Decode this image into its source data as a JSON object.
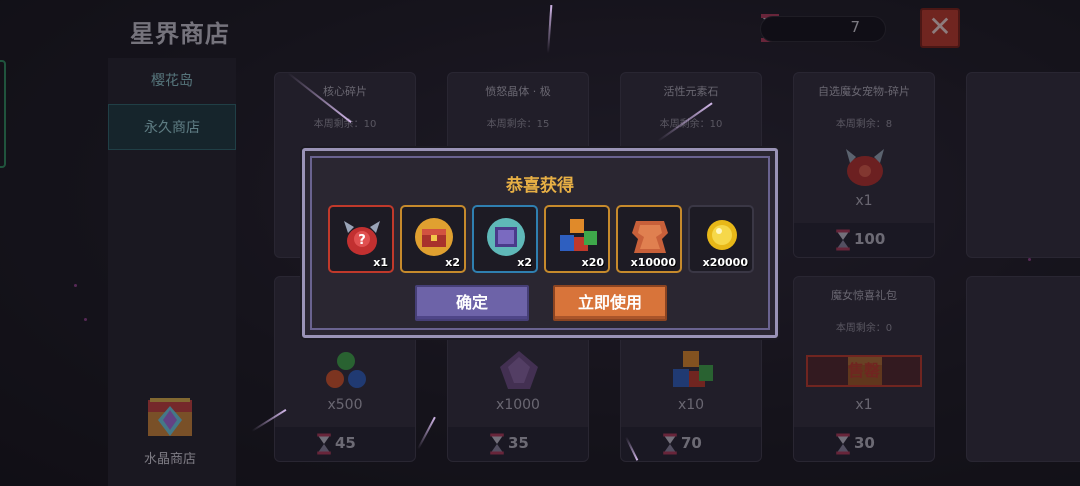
{
  "header": {
    "title": "星界商店",
    "currency_value": "7",
    "close_label": "✕"
  },
  "sidebar": {
    "items": [
      {
        "label": "樱花岛"
      },
      {
        "label": "永久商店"
      }
    ],
    "crystal_shop_label": "水晶商店"
  },
  "cards": [
    {
      "name": "核心碎片",
      "limit": "本周剩余：10",
      "qty": "",
      "price": ""
    },
    {
      "name": "愤怒晶体 · 极",
      "limit": "本周剩余：15",
      "qty": "",
      "price": ""
    },
    {
      "name": "活性元素石",
      "limit": "本周剩余：10",
      "qty": "",
      "price": ""
    },
    {
      "name": "自选魔女宠物-碎片",
      "limit": "本周剩余：8",
      "qty": "x1",
      "price": "100"
    },
    {
      "name": "",
      "limit": "",
      "qty": "x500",
      "price": "45"
    },
    {
      "name": "",
      "limit": "",
      "qty": "x1000",
      "price": "35"
    },
    {
      "name": "",
      "limit": "",
      "qty": "x10",
      "price": "70"
    },
    {
      "name": "魔女惊喜礼包",
      "limit": "本周剩余：0",
      "qty": "x1",
      "price": "30",
      "sold_out": "售罄"
    }
  ],
  "modal": {
    "title": "恭喜获得",
    "rewards": [
      {
        "qty": "x1",
        "icon": "mystery-egg-icon",
        "border": "#c0392b"
      },
      {
        "qty": "x2",
        "icon": "chest-icon",
        "border": "#c68a2c"
      },
      {
        "qty": "x2",
        "icon": "scroll-device-icon",
        "border": "#2f7fb0"
      },
      {
        "qty": "x20",
        "icon": "element-cubes-icon",
        "border": "#c68a2c"
      },
      {
        "qty": "x10000",
        "icon": "leather-hide-icon",
        "border": "#c68a2c"
      },
      {
        "qty": "x20000",
        "icon": "gold-coin-icon",
        "border": "#3a3745"
      }
    ],
    "confirm_label": "确定",
    "use_label": "立即使用"
  },
  "colors": {
    "accent_gold": "#e8b045",
    "confirm_purple": "#6d63a8",
    "use_orange": "#d8743a",
    "close_red": "#c0392b",
    "active_tab_teal": "#1d3a40"
  }
}
